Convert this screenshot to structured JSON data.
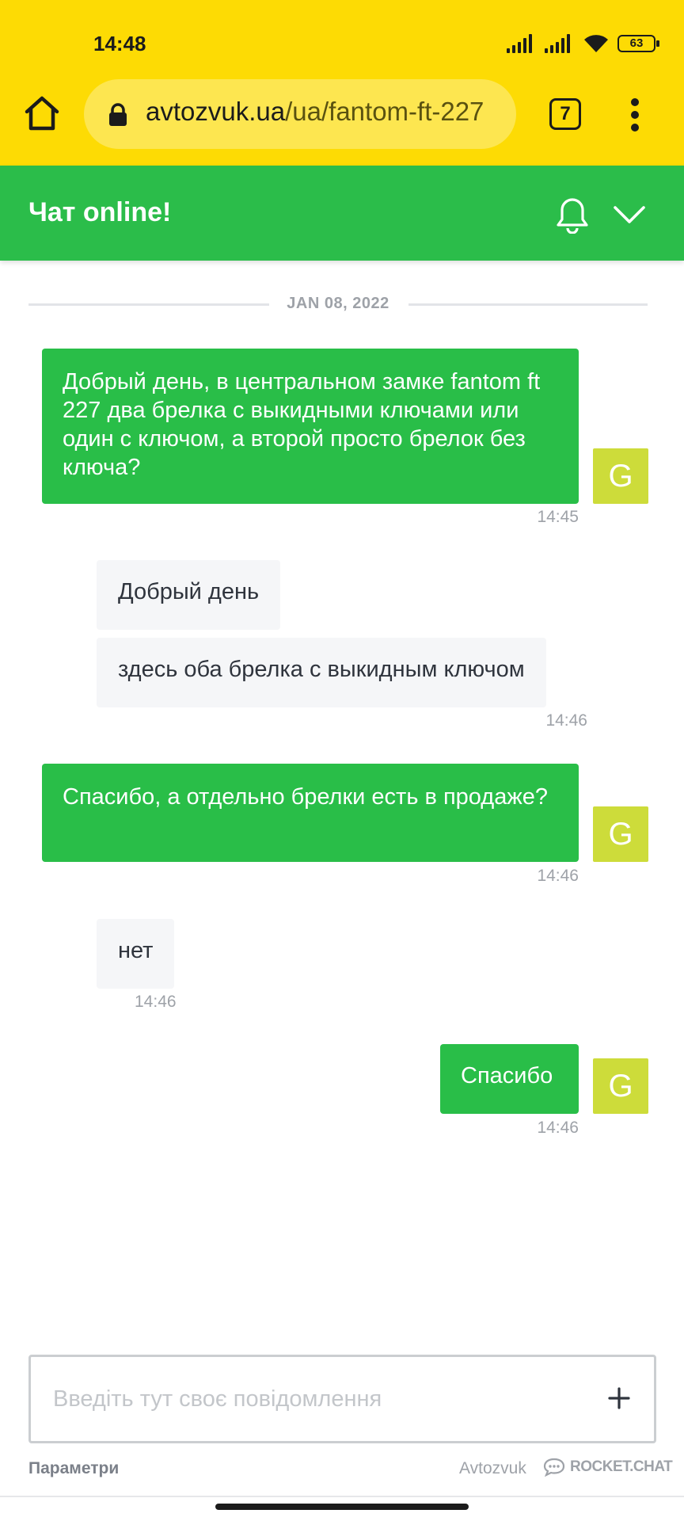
{
  "status_bar": {
    "time": "14:48",
    "battery": "63"
  },
  "browser": {
    "url_host": "avtozvuk.ua",
    "url_path": "/ua/fantom-ft-227",
    "tab_count": "7"
  },
  "chat": {
    "title": "Чат online!",
    "date_divider": "JAN 08, 2022",
    "messages": [
      {
        "text": "Добрый день, в центральном замке fantom ft 227 два брелка с выкидными ключами или один с ключом, а второй просто брелок без ключа?",
        "time": "14:45",
        "avatar": "G"
      },
      {
        "text": "Добрый день"
      },
      {
        "text": "здесь оба брелка с выкидным ключом",
        "time": "14:46"
      },
      {
        "text": "Спасибо, а отдельно брелки есть в продаже?",
        "time": "14:46",
        "avatar": "G"
      },
      {
        "text": "нет",
        "time": "14:46"
      },
      {
        "text": "Спасибо",
        "time": "14:46",
        "avatar": "G"
      }
    ]
  },
  "composer": {
    "placeholder": "Введіть тут своє повідомлення"
  },
  "footer": {
    "options_label": "Параметри",
    "brand": "Avtozvuk",
    "powered_by": "ROCKET.CHAT"
  },
  "colors": {
    "browser_bar": "#fddb04",
    "chat_green": "#2bbd4a",
    "avatar_bg": "#cddc3a",
    "incoming_bg": "#f5f6f8"
  }
}
